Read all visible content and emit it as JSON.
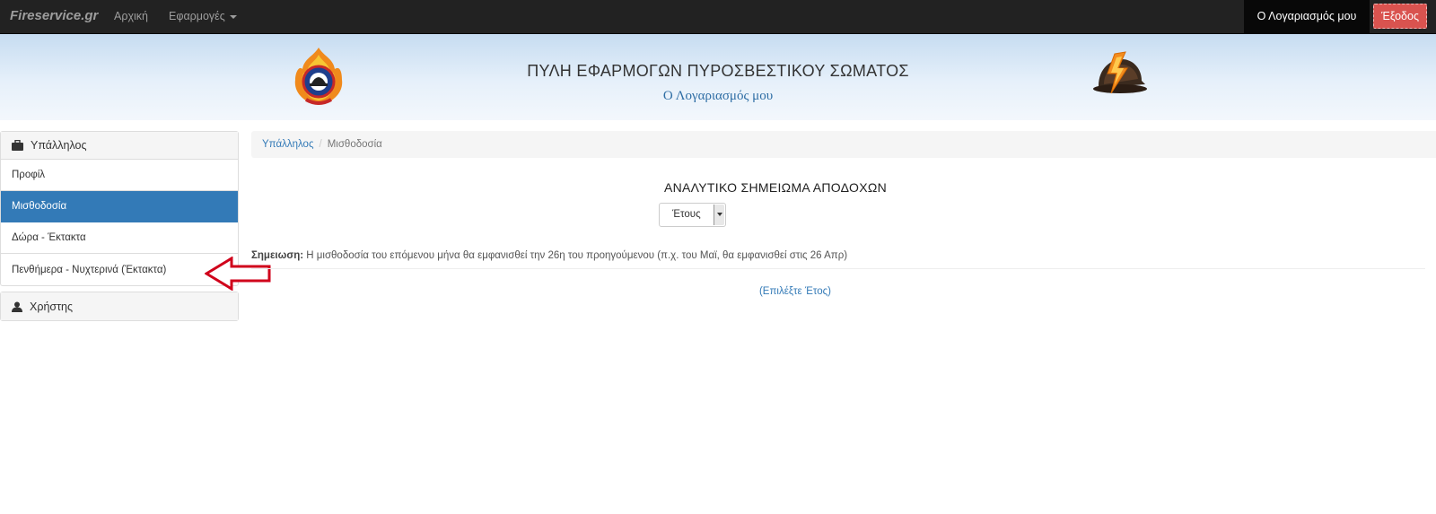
{
  "navbar": {
    "brand": "Fireservice.gr",
    "home": "Αρχική",
    "apps": "Εφαρμογές",
    "account": "Ο Λογαριασμός μου",
    "logout": "Έξοδος"
  },
  "banner": {
    "title": "ΠΥΛΗ ΕΦΑΡΜΟΓΩΝ ΠΥΡΟΣΒΕΣΤΙΚΟΥ ΣΩΜΑΤΟΣ",
    "subtitle": "Ο Λογαριασμός μου"
  },
  "sidebar": {
    "employee_heading": "Υπάλληλος",
    "items": [
      {
        "label": "Προφίλ"
      },
      {
        "label": "Μισθοδοσία"
      },
      {
        "label": "Δώρα - Έκτακτα"
      },
      {
        "label": "Πενθήμερα - Νυχτερινά (Έκτακτα)"
      }
    ],
    "user_heading": "Χρήστης"
  },
  "breadcrumb": {
    "parent": "Υπάλληλος",
    "current": "Μισθοδοσία"
  },
  "main": {
    "title": "ΑΝΑΛΥΤΙΚΟ ΣΗΜΕΙΩΜΑ ΑΠΟΔΟΧΩΝ",
    "year_select": "Έτους",
    "note_label": "Σημειωση:",
    "note_text": " Η μισθοδοσία του επόμενου μήνα θα εμφανισθεί την 26η του προηγούμενου (π.χ. του Μαϊ, θα εμφανισθεί στις 26 Απρ)",
    "choose_year": "(Επιλέξτε Έτος)"
  },
  "colors": {
    "navbar": "#222222",
    "active": "#337ab7",
    "logout": "#d9534f",
    "annotation_arrow": "#d0021b"
  }
}
